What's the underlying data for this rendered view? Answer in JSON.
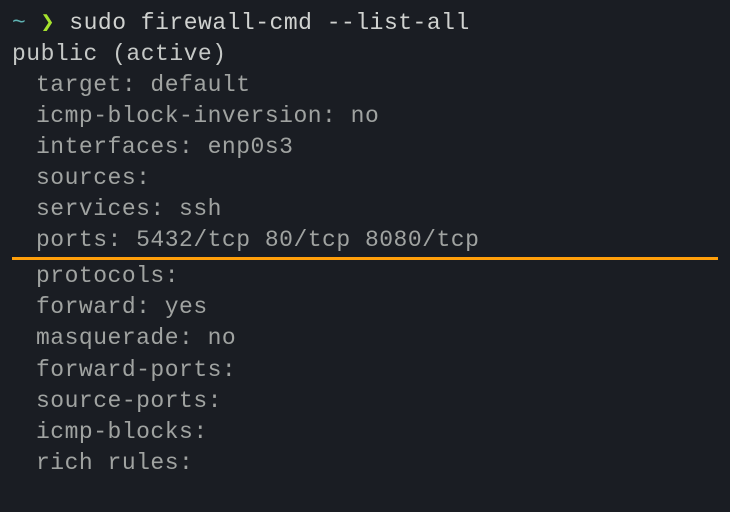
{
  "prompt": {
    "tilde": "~",
    "chevron": "❯",
    "command": "sudo firewall-cmd --list-all"
  },
  "output": {
    "zone": "public (active)",
    "fields": [
      "target: default",
      "icmp-block-inversion: no",
      "interfaces: enp0s3",
      "sources:",
      "services: ssh",
      "ports: 5432/tcp 80/tcp 8080/tcp",
      "protocols:",
      "forward: yes",
      "masquerade: no",
      "forward-ports:",
      "source-ports:",
      "icmp-blocks:",
      "rich rules:"
    ]
  }
}
